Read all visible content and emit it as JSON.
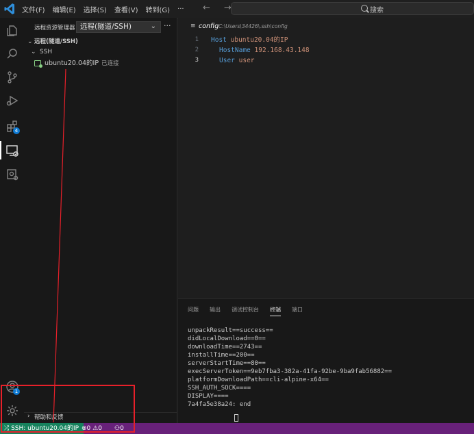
{
  "titlebar": {
    "menu": [
      "文件(F)",
      "编辑(E)",
      "选择(S)",
      "查看(V)",
      "转到(G)",
      "···"
    ],
    "nav": "← →",
    "search_placeholder": "搜索"
  },
  "activitybar": {
    "icons": [
      "explorer-icon",
      "search-icon",
      "source-control-icon",
      "run-debug-icon",
      "extensions-icon",
      "remote-explorer-icon",
      "docker-icon",
      "account-icon",
      "settings-gear-icon"
    ],
    "extensions_badge": "4",
    "account_badge": "1"
  },
  "sidebar": {
    "title": "远程资源管理器",
    "dropdown_value": "远程(隧道/SSH)",
    "more": "···",
    "section_title": "远程(隧道/SSH)",
    "group": "SSH",
    "host_label": "ubuntu20.04的IP",
    "host_status": "已连接",
    "help_section": "帮助和反馈"
  },
  "editor": {
    "file_name": "config",
    "file_path": "C:\\Users\\34426\\.ssh\\config",
    "lines": [
      {
        "num": "1",
        "key": "Host",
        "value": "ubuntu20.04的IP"
      },
      {
        "num": "2",
        "key": "HostName",
        "value": "192.168.43.148"
      },
      {
        "num": "3",
        "key": "User",
        "value": "user"
      }
    ]
  },
  "panel": {
    "tabs": [
      "问题",
      "输出",
      "调试控制台",
      "终端",
      "端口"
    ],
    "active_tab": "终端",
    "terminal_lines": [
      "unpackResult==success==",
      "didLocalDownload==0==",
      "downloadTime==2743==",
      "installTime==200==",
      "serverStartTime==80==",
      "execServerToken==9eb7fba3-382a-41fa-92be-9ba9fab56882==",
      "platformDownloadPath==cli-alpine-x64==",
      "SSH_AUTH_SOCK====",
      "DISPLAY====",
      "7a4fa5e38a24: end"
    ]
  },
  "statusbar": {
    "remote": "SSH: ubuntu20.04的IP",
    "errors": "0",
    "warnings": "0",
    "ports": "0"
  },
  "colors": {
    "statusbar_bg": "#68217a",
    "remote_bg": "#16825d",
    "annotation_red": "#e8202a"
  }
}
